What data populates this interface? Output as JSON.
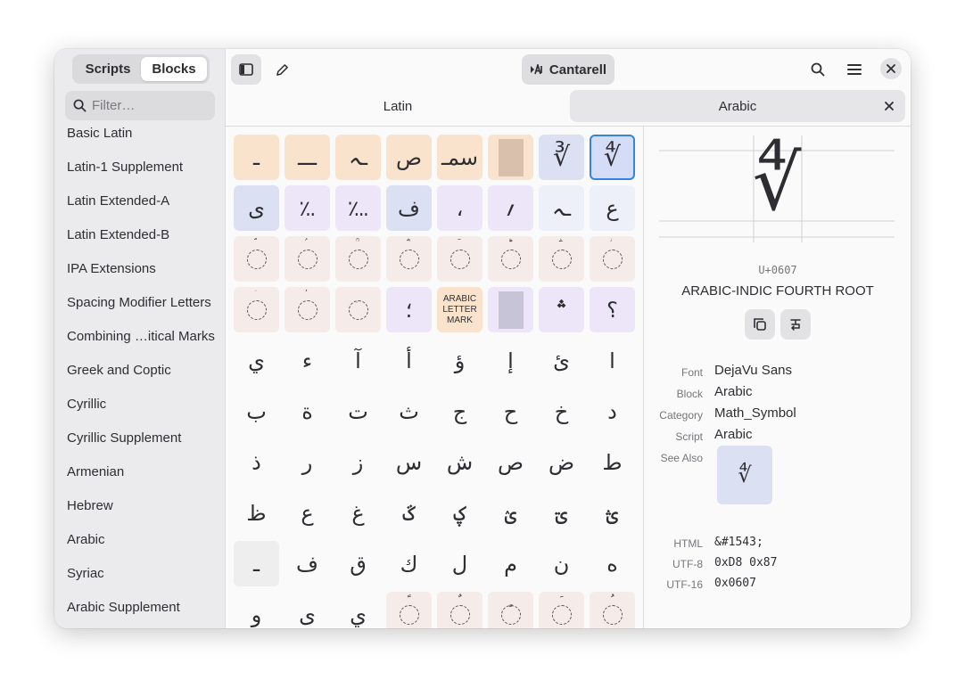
{
  "sidebar": {
    "view_tabs": [
      "Scripts",
      "Blocks"
    ],
    "active_view": "Blocks",
    "filter_placeholder": "Filter…",
    "blocks": [
      "Basic Latin",
      "Latin-1 Supplement",
      "Latin Extended-A",
      "Latin Extended-B",
      "IPA Extensions",
      "Spacing Modifier Letters",
      "Combining …itical Marks",
      "Greek and Coptic",
      "Cyrillic",
      "Cyrillic Supplement",
      "Armenian",
      "Hebrew",
      "Arabic",
      "Syriac",
      "Arabic Supplement"
    ]
  },
  "header": {
    "font_button_label": "Cantarell",
    "tabs": [
      {
        "label": "Latin",
        "active": false
      },
      {
        "label": "Arabic",
        "active": true
      }
    ],
    "icons": [
      "sidebar-toggle-icon",
      "pencil-icon",
      "font-icon",
      "search-icon",
      "menu-icon",
      "close-icon"
    ]
  },
  "grid": {
    "rows": [
      [
        {
          "ch": "ـ",
          "c": "tan"
        },
        {
          "ch": "ـــ",
          "c": "tan"
        },
        {
          "ch": "ـہ",
          "c": "tan"
        },
        {
          "ch": "ص",
          "c": "tan"
        },
        {
          "ch": "سمـ",
          "c": "tan"
        },
        {
          "ch": "",
          "c": "tanbox"
        },
        {
          "ch": "∛",
          "c": "blue"
        },
        {
          "ch": "∜",
          "c": "sel"
        }
      ],
      [
        {
          "ch": "ى",
          "c": "blue"
        },
        {
          "ch": "؉",
          "c": "lav"
        },
        {
          "ch": "؊",
          "c": "lav"
        },
        {
          "ch": "ف",
          "c": "blue"
        },
        {
          "ch": "،",
          "c": "lav"
        },
        {
          "ch": "؍",
          "c": "lav"
        },
        {
          "ch": "ـہ",
          "c": "pale"
        },
        {
          "ch": "ع",
          "c": "pale"
        }
      ],
      [
        {
          "ch": "ؐ",
          "c": "pink",
          "d": 1
        },
        {
          "ch": "ؑ",
          "c": "pink",
          "d": 1
        },
        {
          "ch": "ؒ",
          "c": "pink",
          "d": 1
        },
        {
          "ch": "ؓ",
          "c": "pink",
          "d": 1
        },
        {
          "ch": "ؔ",
          "c": "pink",
          "d": 1
        },
        {
          "ch": "ؕ",
          "c": "pink",
          "d": 1
        },
        {
          "ch": "ؖ",
          "c": "pink",
          "d": 1
        },
        {
          "ch": "ؗ",
          "c": "pink",
          "d": 1
        }
      ],
      [
        {
          "ch": "ؘ",
          "c": "pink",
          "d": 1
        },
        {
          "ch": "ؙ",
          "c": "pink",
          "d": 1
        },
        {
          "ch": "ؚ",
          "c": "pink",
          "d": 1
        },
        {
          "ch": "؛",
          "c": "lav"
        },
        {
          "ch": "ARABIC LETTER MARK",
          "c": "tan",
          "s": 1
        },
        {
          "ch": "",
          "c": "lav",
          "b": 1
        },
        {
          "ch": "؞",
          "c": "lav"
        },
        {
          "ch": "؟",
          "c": "lav"
        }
      ],
      [
        {
          "ch": "ي"
        },
        {
          "ch": "ء"
        },
        {
          "ch": "آ"
        },
        {
          "ch": "أ"
        },
        {
          "ch": "ؤ"
        },
        {
          "ch": "إ"
        },
        {
          "ch": "ئ"
        },
        {
          "ch": "ا"
        }
      ],
      [
        {
          "ch": "ب"
        },
        {
          "ch": "ة"
        },
        {
          "ch": "ت"
        },
        {
          "ch": "ث"
        },
        {
          "ch": "ج"
        },
        {
          "ch": "ح"
        },
        {
          "ch": "خ"
        },
        {
          "ch": "د"
        }
      ],
      [
        {
          "ch": "ذ"
        },
        {
          "ch": "ر"
        },
        {
          "ch": "ز"
        },
        {
          "ch": "س"
        },
        {
          "ch": "ش"
        },
        {
          "ch": "ص"
        },
        {
          "ch": "ض"
        },
        {
          "ch": "ط"
        }
      ],
      [
        {
          "ch": "ظ"
        },
        {
          "ch": "ع"
        },
        {
          "ch": "غ"
        },
        {
          "ch": "ػ"
        },
        {
          "ch": "ؼ"
        },
        {
          "ch": "ؽ"
        },
        {
          "ch": "ؾ"
        },
        {
          "ch": "ؿ"
        }
      ],
      [
        {
          "ch": "ـ",
          "c": "grey"
        },
        {
          "ch": "ف"
        },
        {
          "ch": "ق"
        },
        {
          "ch": "ك"
        },
        {
          "ch": "ل"
        },
        {
          "ch": "م"
        },
        {
          "ch": "ن"
        },
        {
          "ch": "ه"
        }
      ],
      [
        {
          "ch": "و"
        },
        {
          "ch": "ى"
        },
        {
          "ch": "ي"
        },
        {
          "ch": "ً",
          "c": "pink",
          "d": 1
        },
        {
          "ch": "ٌ",
          "c": "pink",
          "d": 1
        },
        {
          "ch": "ٍ",
          "c": "pink",
          "d": 1
        },
        {
          "ch": "َ",
          "c": "pink",
          "d": 1
        },
        {
          "ch": "ُ",
          "c": "pink",
          "d": 1
        }
      ]
    ]
  },
  "details": {
    "preview_char": "∜",
    "codepoint": "U+0607",
    "name": "ARABIC-INDIC FOURTH ROOT",
    "properties": [
      {
        "label": "Font",
        "value": "DejaVu Sans"
      },
      {
        "label": "Block",
        "value": "Arabic"
      },
      {
        "label": "Category",
        "value": "Math_Symbol"
      },
      {
        "label": "Script",
        "value": "Arabic"
      }
    ],
    "see_also_label": "See Also",
    "see_also_char": "∜",
    "encodings": [
      {
        "label": "HTML",
        "value": "&#1543;"
      },
      {
        "label": "UTF-8",
        "value": "0xD8 0x87"
      },
      {
        "label": "UTF-16",
        "value": "0x0607"
      }
    ],
    "accent_color": "#3584e4"
  }
}
